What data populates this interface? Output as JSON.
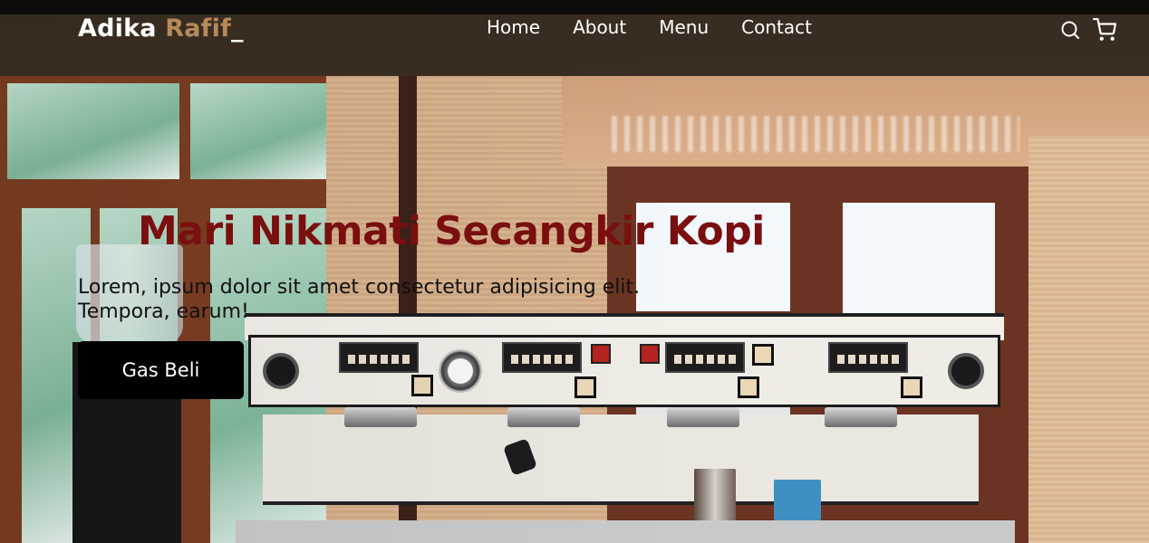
{
  "brand": {
    "name": "Adika",
    "accent": "Rafif",
    "suffix": "_",
    "accent_color": "#b6895b"
  },
  "nav": {
    "links": [
      "Home",
      "About",
      "Menu",
      "Contact"
    ],
    "icons": [
      "search-icon",
      "shopping-cart-icon"
    ]
  },
  "hero": {
    "title": "Mari Nikmati Secangkir Kopi",
    "title_color": "#7a0f0f",
    "paragraph": "Lorem, ipsum dolor sit amet consectetur adipisicing elit. Tempora, earum!",
    "cta_label": "Gas Beli"
  }
}
